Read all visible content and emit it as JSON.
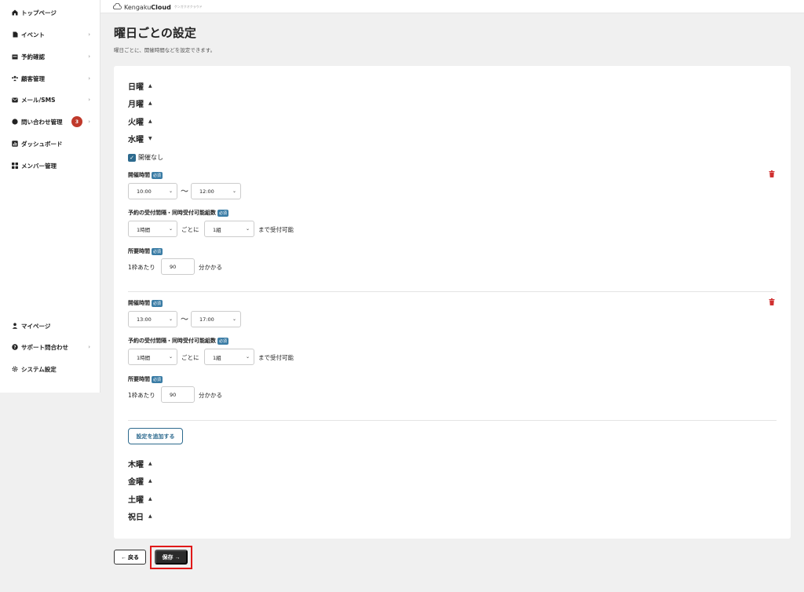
{
  "sidebar": {
    "items": [
      {
        "label": "トップページ",
        "chevron": ""
      },
      {
        "label": "イベント",
        "chevron": "›"
      },
      {
        "label": "予約確認",
        "chevron": "›"
      },
      {
        "label": "顧客管理",
        "chevron": "›"
      },
      {
        "label": "メール/SMS",
        "chevron": "›"
      },
      {
        "label": "問い合わせ管理",
        "chevron": "›",
        "badge": "3"
      },
      {
        "label": "ダッシュボード",
        "chevron": ""
      },
      {
        "label": "メンバー管理",
        "chevron": ""
      }
    ],
    "bottom_items": [
      {
        "label": "マイページ",
        "chevron": ""
      },
      {
        "label": "サポート問合わせ",
        "chevron": "›"
      },
      {
        "label": "システム設定",
        "chevron": ""
      }
    ]
  },
  "header": {
    "logo_text": "Kengaku",
    "logo_bold": "Cloud",
    "logo_sub": "ケンガクオクラウド"
  },
  "page": {
    "title": "曜日ごとの設定",
    "subtitle": "曜日ごとに、開催時間などを設定できます。"
  },
  "days": {
    "sun": "日曜",
    "mon": "月曜",
    "tue": "火曜",
    "wed": "水曜",
    "thu": "木曜",
    "fri": "金曜",
    "sat": "土曜",
    "hol": "祝日"
  },
  "wednesday": {
    "no_event_label": "開催なし",
    "no_event_checked": true,
    "required_badge": "必須",
    "time_label": "開催時間",
    "interval_label": "予約の受付間隔・同時受付可能組数",
    "duration_label": "所要時間",
    "tilde": "〜",
    "per_text": "ごとに",
    "accept_text": "まで受付可能",
    "slot_prefix": "1枠あたり",
    "slot_suffix": "分かかる",
    "blocks": [
      {
        "start": "10:00",
        "end": "12:00",
        "interval": "1時間",
        "groups": "1組",
        "minutes": "90"
      },
      {
        "start": "13:00",
        "end": "17:00",
        "interval": "1時間",
        "groups": "1組",
        "minutes": "90"
      }
    ],
    "add_button": "設定を追加する"
  },
  "footer": {
    "back_label": "← 戻る",
    "save_label": "保存 →"
  },
  "colors": {
    "accent": "#2d6a8e",
    "badge": "#c0392b",
    "danger": "#d03030",
    "highlight": "#e01919"
  }
}
